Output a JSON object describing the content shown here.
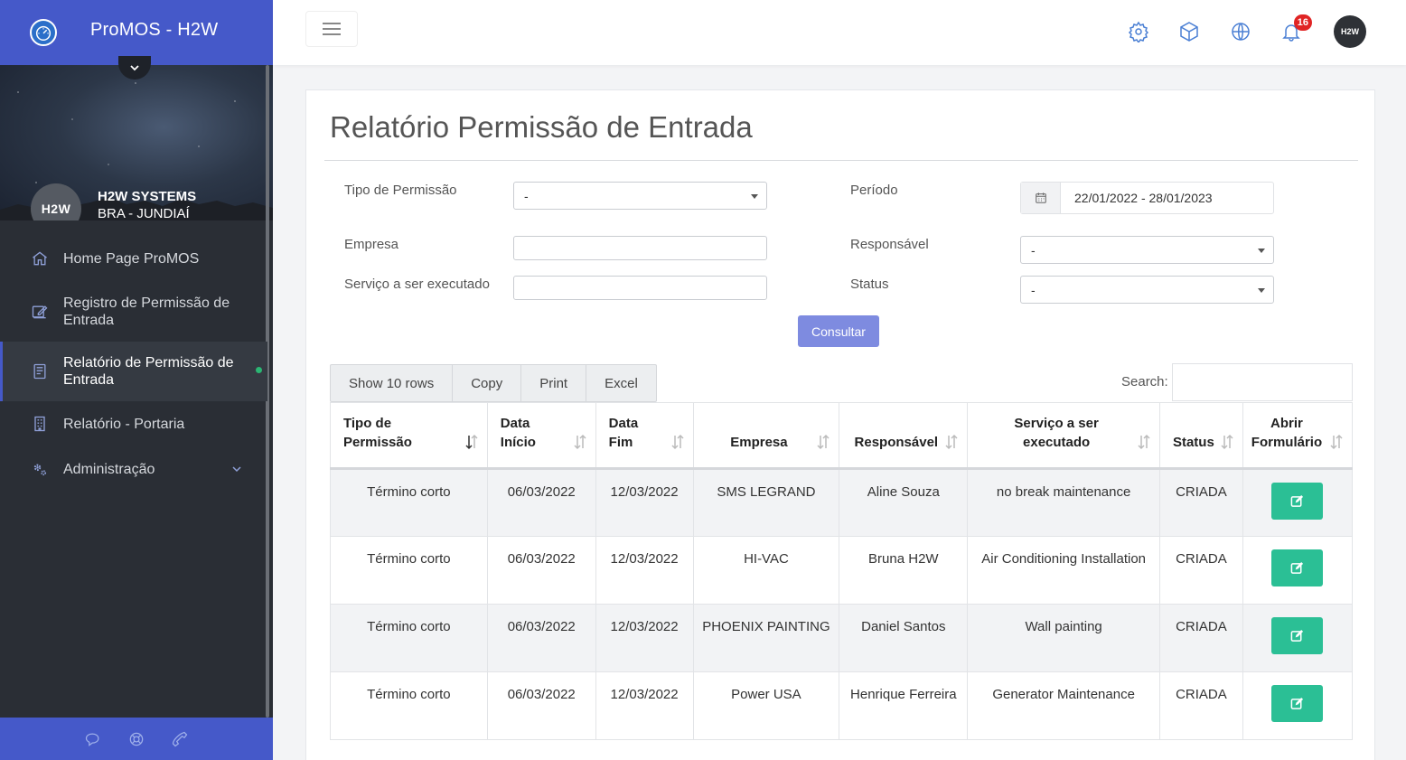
{
  "app": {
    "title": "ProMOS - H2W"
  },
  "user": {
    "avatar_text": "H2W",
    "name": "H2W SYSTEMS",
    "location": "BRA - JUNDIAÍ"
  },
  "nav": {
    "items": [
      {
        "label": "Home Page ProMOS",
        "icon": "home-icon"
      },
      {
        "label": "Registro de Permissão de Entrada",
        "icon": "edit-icon"
      },
      {
        "label": "Relatório de Permissão de Entrada",
        "icon": "book-icon",
        "active": true
      },
      {
        "label": "Relatório - Portaria",
        "icon": "building-icon"
      },
      {
        "label": "Administração",
        "icon": "gears-icon",
        "has_submenu": true
      }
    ]
  },
  "footer_icons": [
    "chat-icon",
    "lifebuoy-icon",
    "phone-icon"
  ],
  "topbar": {
    "icons": [
      "gear-icon",
      "cube-icon",
      "globe-icon",
      "bell-icon"
    ],
    "notification_count": "16",
    "avatar_text": "H2W"
  },
  "page": {
    "title": "Relatório Permissão de Entrada"
  },
  "filters": {
    "tipo_label": "Tipo de Permissão",
    "tipo_value": "-",
    "empresa_label": "Empresa",
    "empresa_value": "",
    "servico_label": "Serviço a ser executado",
    "servico_value": "",
    "periodo_label": "Período",
    "periodo_value": "22/01/2022 - 28/01/2023",
    "responsavel_label": "Responsável",
    "responsavel_value": "-",
    "status_label": "Status",
    "status_value": "-",
    "submit_label": "Consultar"
  },
  "table_tools": {
    "buttons": [
      "Show 10 rows",
      "Copy",
      "Print",
      "Excel"
    ],
    "search_label": "Search:",
    "search_value": ""
  },
  "table": {
    "headers": [
      "Tipo de Permissão",
      "Data Início",
      "Data Fim",
      "Empresa",
      "Responsável",
      "Serviço a ser executado",
      "Status",
      "Abrir Formulário"
    ],
    "rows": [
      [
        "Término corto",
        "06/03/2022",
        "12/03/2022",
        "SMS LEGRAND",
        "Aline Souza",
        "no break maintenance",
        "CRIADA"
      ],
      [
        "Término corto",
        "06/03/2022",
        "12/03/2022",
        "HI-VAC",
        "Bruna H2W",
        "Air Conditioning Installation",
        "CRIADA"
      ],
      [
        "Término corto",
        "06/03/2022",
        "12/03/2022",
        "PHOENIX PAINTING",
        "Daniel Santos",
        "Wall painting",
        "CRIADA"
      ],
      [
        "Término corto",
        "06/03/2022",
        "12/03/2022",
        "Power USA",
        "Henrique Ferreira",
        "Generator Maintenance",
        "CRIADA"
      ]
    ]
  },
  "colors": {
    "brand": "#4559c9",
    "sidebar": "#2a2e35",
    "action": "#2bbf95",
    "badge": "#e02424",
    "consultar": "#7e8be0"
  }
}
